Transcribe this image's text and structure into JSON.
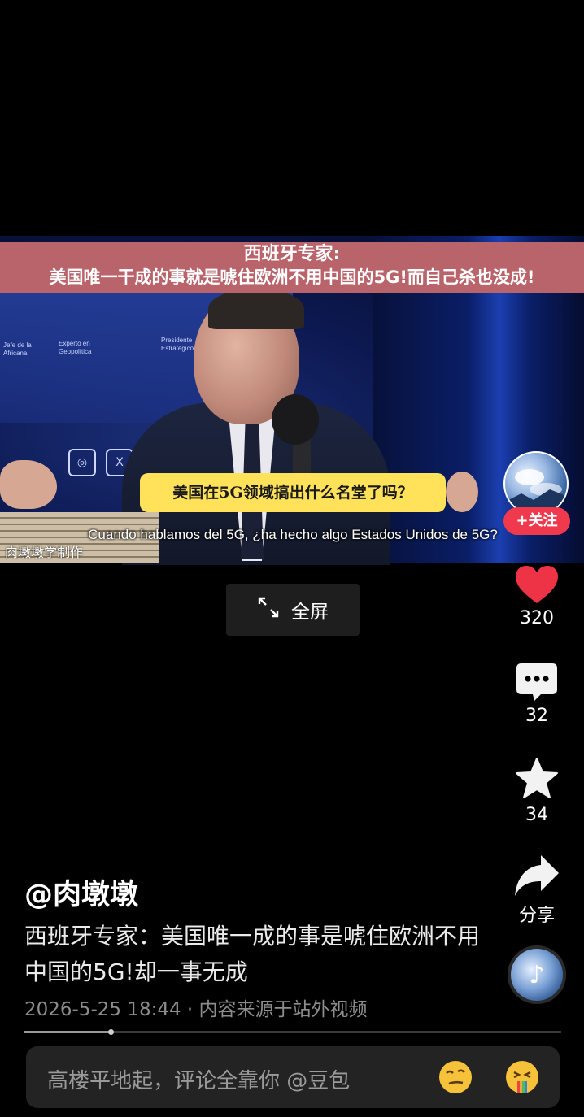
{
  "video": {
    "title_line1": "西班牙专家:",
    "title_line2": "美国唯一干成的事就是唬住欧洲不用中国的5G!而自己杀也没成!",
    "subtitle_cn": "美国在5G领域搞出什么名堂了吗？",
    "subtitle_es": "Cuando hablamos del 5G, ¿ha hecho algo Estados Unidos de 5G?",
    "watermark": "肉墩墩学制作",
    "panel_text_1": "Experto en Geopolítica",
    "panel_text_2": "Presidente Estratégico",
    "panel_text_3": "Jefe de la Africana"
  },
  "fullscreen": {
    "label": "全屏"
  },
  "rail": {
    "follow_label": "+关注",
    "like_count": "320",
    "comment_count": "32",
    "favorite_count": "34",
    "share_label": "分享",
    "like_color": "#ee3346"
  },
  "post": {
    "author": "@肉墩墩",
    "description": "西班牙专家：美国唯一成的事是唬住欧洲不用中国的5G!却一事无成",
    "meta": "2026-5-25 18:44 · 内容来源于站外视频",
    "progress": 0.16
  },
  "comment_bar": {
    "placeholder": "高楼平地起，评论全靠你  @豆包"
  }
}
